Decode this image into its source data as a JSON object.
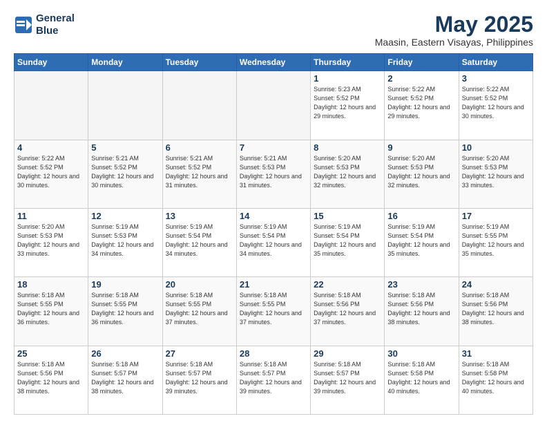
{
  "header": {
    "logo_line1": "General",
    "logo_line2": "Blue",
    "title": "May 2025",
    "subtitle": "Maasin, Eastern Visayas, Philippines"
  },
  "days_of_week": [
    "Sunday",
    "Monday",
    "Tuesday",
    "Wednesday",
    "Thursday",
    "Friday",
    "Saturday"
  ],
  "weeks": [
    [
      {
        "day": "",
        "empty": true
      },
      {
        "day": "",
        "empty": true
      },
      {
        "day": "",
        "empty": true
      },
      {
        "day": "",
        "empty": true
      },
      {
        "day": "1",
        "rise": "5:23 AM",
        "set": "5:52 PM",
        "daylight": "12 hours and 29 minutes."
      },
      {
        "day": "2",
        "rise": "5:22 AM",
        "set": "5:52 PM",
        "daylight": "12 hours and 29 minutes."
      },
      {
        "day": "3",
        "rise": "5:22 AM",
        "set": "5:52 PM",
        "daylight": "12 hours and 30 minutes."
      }
    ],
    [
      {
        "day": "4",
        "rise": "5:22 AM",
        "set": "5:52 PM",
        "daylight": "12 hours and 30 minutes."
      },
      {
        "day": "5",
        "rise": "5:21 AM",
        "set": "5:52 PM",
        "daylight": "12 hours and 30 minutes."
      },
      {
        "day": "6",
        "rise": "5:21 AM",
        "set": "5:52 PM",
        "daylight": "12 hours and 31 minutes."
      },
      {
        "day": "7",
        "rise": "5:21 AM",
        "set": "5:53 PM",
        "daylight": "12 hours and 31 minutes."
      },
      {
        "day": "8",
        "rise": "5:20 AM",
        "set": "5:53 PM",
        "daylight": "12 hours and 32 minutes."
      },
      {
        "day": "9",
        "rise": "5:20 AM",
        "set": "5:53 PM",
        "daylight": "12 hours and 32 minutes."
      },
      {
        "day": "10",
        "rise": "5:20 AM",
        "set": "5:53 PM",
        "daylight": "12 hours and 33 minutes."
      }
    ],
    [
      {
        "day": "11",
        "rise": "5:20 AM",
        "set": "5:53 PM",
        "daylight": "12 hours and 33 minutes."
      },
      {
        "day": "12",
        "rise": "5:19 AM",
        "set": "5:53 PM",
        "daylight": "12 hours and 34 minutes."
      },
      {
        "day": "13",
        "rise": "5:19 AM",
        "set": "5:54 PM",
        "daylight": "12 hours and 34 minutes."
      },
      {
        "day": "14",
        "rise": "5:19 AM",
        "set": "5:54 PM",
        "daylight": "12 hours and 34 minutes."
      },
      {
        "day": "15",
        "rise": "5:19 AM",
        "set": "5:54 PM",
        "daylight": "12 hours and 35 minutes."
      },
      {
        "day": "16",
        "rise": "5:19 AM",
        "set": "5:54 PM",
        "daylight": "12 hours and 35 minutes."
      },
      {
        "day": "17",
        "rise": "5:19 AM",
        "set": "5:55 PM",
        "daylight": "12 hours and 35 minutes."
      }
    ],
    [
      {
        "day": "18",
        "rise": "5:18 AM",
        "set": "5:55 PM",
        "daylight": "12 hours and 36 minutes."
      },
      {
        "day": "19",
        "rise": "5:18 AM",
        "set": "5:55 PM",
        "daylight": "12 hours and 36 minutes."
      },
      {
        "day": "20",
        "rise": "5:18 AM",
        "set": "5:55 PM",
        "daylight": "12 hours and 37 minutes."
      },
      {
        "day": "21",
        "rise": "5:18 AM",
        "set": "5:55 PM",
        "daylight": "12 hours and 37 minutes."
      },
      {
        "day": "22",
        "rise": "5:18 AM",
        "set": "5:56 PM",
        "daylight": "12 hours and 37 minutes."
      },
      {
        "day": "23",
        "rise": "5:18 AM",
        "set": "5:56 PM",
        "daylight": "12 hours and 38 minutes."
      },
      {
        "day": "24",
        "rise": "5:18 AM",
        "set": "5:56 PM",
        "daylight": "12 hours and 38 minutes."
      }
    ],
    [
      {
        "day": "25",
        "rise": "5:18 AM",
        "set": "5:56 PM",
        "daylight": "12 hours and 38 minutes."
      },
      {
        "day": "26",
        "rise": "5:18 AM",
        "set": "5:57 PM",
        "daylight": "12 hours and 38 minutes."
      },
      {
        "day": "27",
        "rise": "5:18 AM",
        "set": "5:57 PM",
        "daylight": "12 hours and 39 minutes."
      },
      {
        "day": "28",
        "rise": "5:18 AM",
        "set": "5:57 PM",
        "daylight": "12 hours and 39 minutes."
      },
      {
        "day": "29",
        "rise": "5:18 AM",
        "set": "5:57 PM",
        "daylight": "12 hours and 39 minutes."
      },
      {
        "day": "30",
        "rise": "5:18 AM",
        "set": "5:58 PM",
        "daylight": "12 hours and 40 minutes."
      },
      {
        "day": "31",
        "rise": "5:18 AM",
        "set": "5:58 PM",
        "daylight": "12 hours and 40 minutes."
      }
    ]
  ]
}
